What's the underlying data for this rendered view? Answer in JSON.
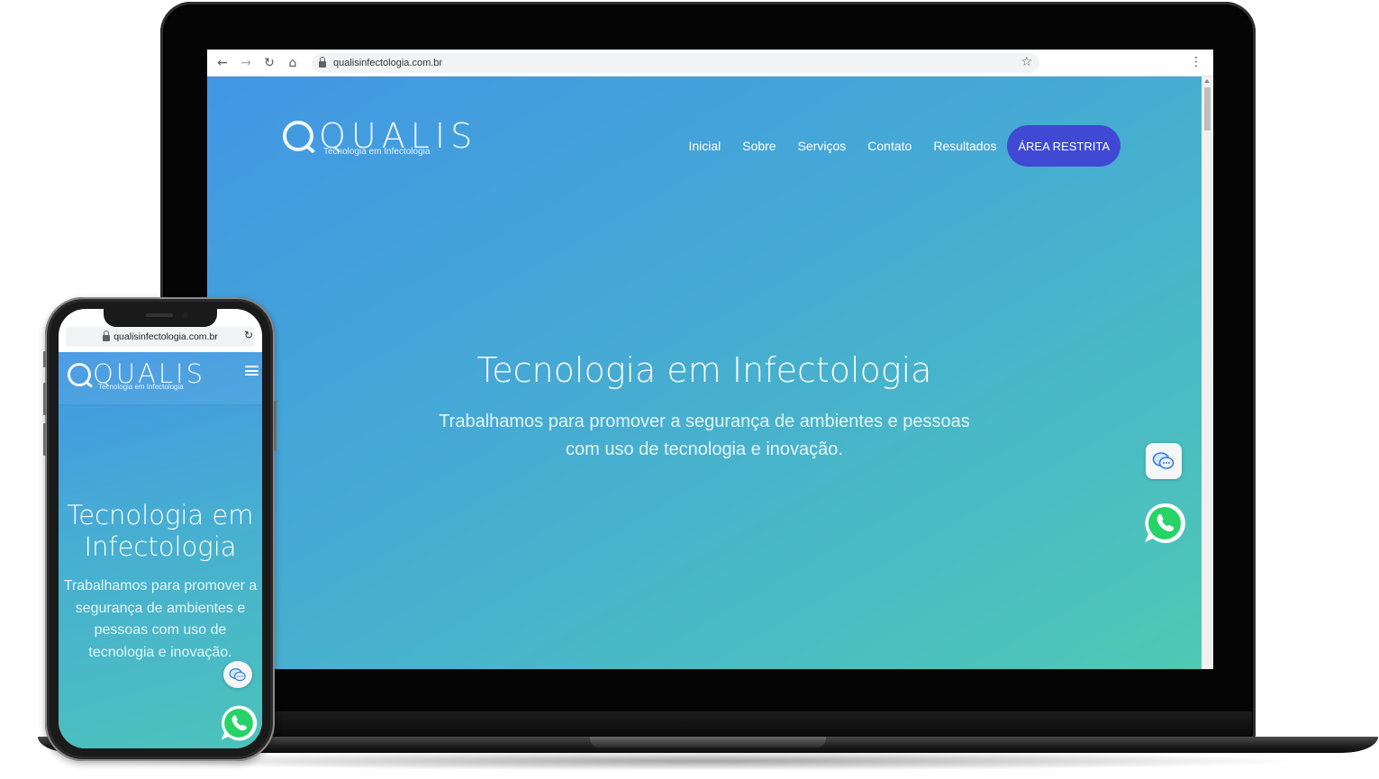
{
  "desktop": {
    "browser": {
      "url": "qualisinfectologia.com.br",
      "icons": [
        "back-arrow-icon",
        "forward-arrow-icon",
        "reload-icon",
        "home-icon",
        "lock-icon",
        "star-icon",
        "more-vert-icon"
      ]
    },
    "header": {
      "logo_word": "QUALIS",
      "logo_tagline": "Tecnologia em Infectologia",
      "nav": [
        "Inicial",
        "Sobre",
        "Serviços",
        "Contato",
        "Resultados"
      ],
      "cta": "ÁREA RESTRITA"
    },
    "hero": {
      "title": "Tecnologia em Infectologia",
      "subtitle_line1": "Trabalhamos para promover a segurança de ambientes e pessoas",
      "subtitle_line2": "com uso de tecnologia e inovação."
    }
  },
  "mobile": {
    "browser": {
      "url": "qualisinfectologia.com.br"
    },
    "header": {
      "logo_word": "QUALIS",
      "logo_tagline": "Tecnologia em Infectologia"
    },
    "hero": {
      "title_line1": "Tecnologia em",
      "title_line2": "Infectologia",
      "subtitle_lines": [
        "Trabalhamos para promover a",
        "segurança de ambientes e",
        "pessoas com uso de",
        "tecnologia e inovação."
      ]
    }
  },
  "colors": {
    "gradient_start": "#4296e4",
    "gradient_end": "#4fc9b4",
    "cta_background": "#3f49d4",
    "whatsapp_green": "#25d366"
  }
}
